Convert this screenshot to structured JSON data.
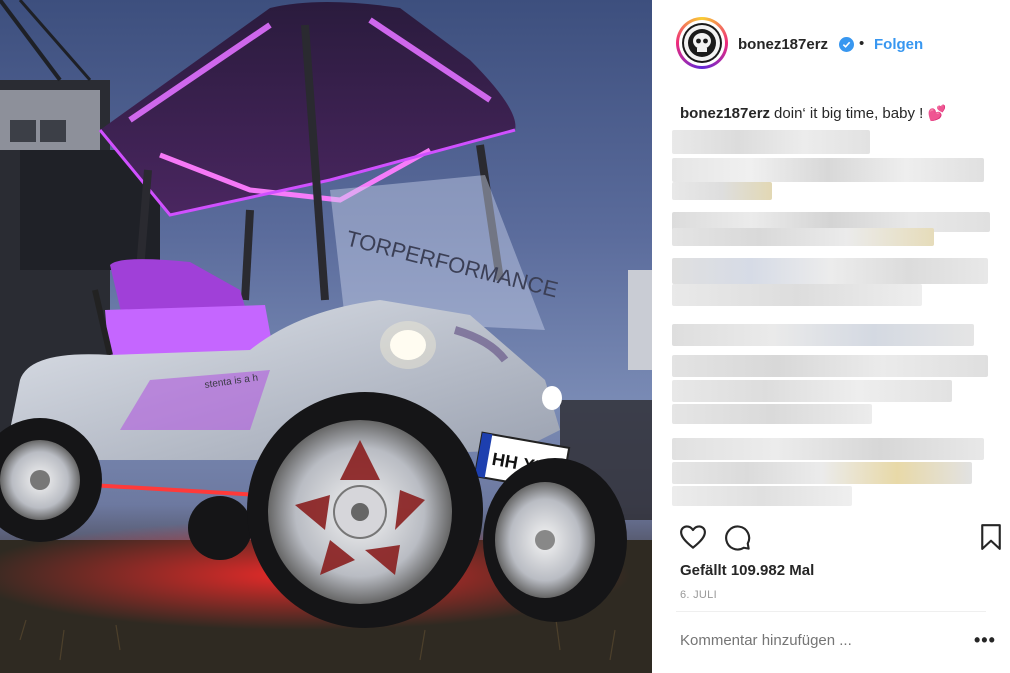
{
  "post": {
    "username": "bonez187erz",
    "follow_label": "Folgen",
    "separator": "•",
    "caption_user": "bonez187erz",
    "caption_text": "doin‘ it big time, baby ! 💕",
    "likes_text": "Gefällt 109.982 Mal",
    "date_text": "6. JULI",
    "comment_placeholder": "Kommentar hinzufügen ...",
    "more_label": "•••"
  },
  "photo": {
    "license_plate": "HH XL 187",
    "windshield_text": "TORPERFORMANCE",
    "side_text": "stenta is a h"
  },
  "icons": {
    "like": "heart-icon",
    "comment": "comment-icon",
    "save": "bookmark-icon",
    "verified": "verified-badge-icon"
  },
  "colors": {
    "link_blue": "#3897f0",
    "text_dark": "#262626",
    "meta_gray": "#999999",
    "neon_purple": "#d050ff",
    "underglow_red": "#ff2a2a"
  }
}
